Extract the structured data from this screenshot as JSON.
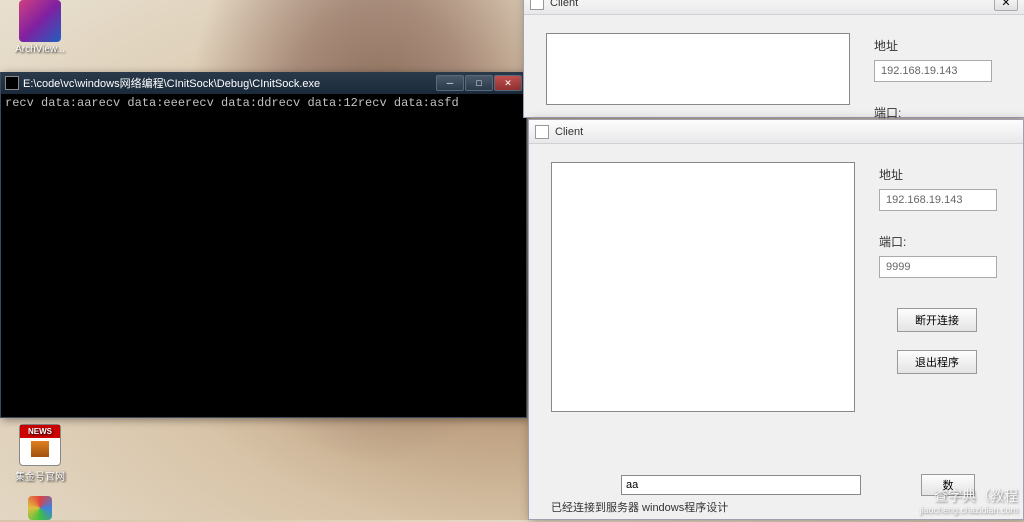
{
  "desktop_icons": {
    "archview": "ArchView...",
    "news_label": "集金号官网",
    "news_header": "NEWS"
  },
  "console": {
    "title": "E:\\code\\vc\\windows网络编程\\CInitSock\\Debug\\CInitSock.exe",
    "output": "recv data:aarecv data:eeerecv data:ddrecv data:12recv data:asfd",
    "btn_min": "─",
    "btn_max": "□",
    "btn_close": "✕"
  },
  "client_back": {
    "title": "Client",
    "address_label": "地址",
    "address_value": "192.168.19.143",
    "port_label": "端口:"
  },
  "client_front": {
    "title": "Client",
    "address_label": "地址",
    "address_value": "192.168.19.143",
    "port_label": "端口:",
    "port_value": "9999",
    "btn_disconnect": "断开连接",
    "btn_exit": "退出程序",
    "input_value": "aa",
    "btn_send": "数",
    "status": "已经连接到服务器 windows程序设计"
  },
  "watermark": {
    "main": "查字典（教程",
    "sub": "jiaocheng.chazidian.com"
  }
}
